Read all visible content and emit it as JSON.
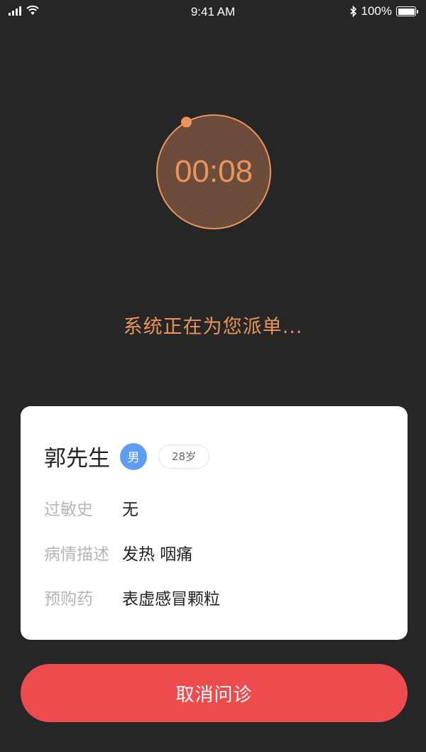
{
  "status_bar": {
    "time": "9:41 AM",
    "battery": "100%",
    "icons": [
      "signal-icon",
      "wifi-icon",
      "bluetooth-icon",
      "battery-icon"
    ]
  },
  "timer": {
    "elapsed": "00:08",
    "progress_fraction": 0.02
  },
  "dispatch_status": "系统正在为您派单...",
  "patient": {
    "name": "郭先生",
    "gender": "男",
    "age": "28岁",
    "fields": [
      {
        "label": "过敏史",
        "value": "无"
      },
      {
        "label": "病情描述",
        "value": "发热 咽痛"
      },
      {
        "label": "预购药",
        "value": "表虚感冒颗粒"
      }
    ]
  },
  "actions": {
    "cancel_label": "取消问诊"
  },
  "colors": {
    "background": "#262626",
    "accent": "#e9955c",
    "card": "#ffffff",
    "gender_badge": "#5b9ef4",
    "cancel_button": "#ee4b4e"
  }
}
